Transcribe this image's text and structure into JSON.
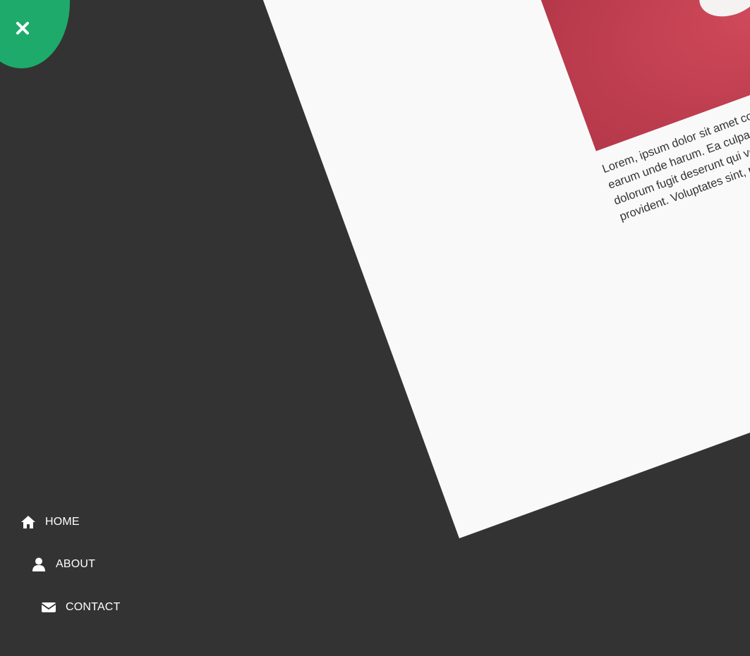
{
  "page": {
    "title_fragment": "p"
  },
  "close_button": {
    "icon": "close-icon",
    "color": "#1eaa6b"
  },
  "nav": {
    "items": [
      {
        "label": "HOME",
        "icon": "home-icon"
      },
      {
        "label": "ABOUT",
        "icon": "user-icon"
      },
      {
        "label": "CONTACT",
        "icon": "envelope-icon"
      }
    ]
  },
  "caption": {
    "lines": [
      "Lorem, ipsum dolor sit amet consectetur adipi",
      "earum unde harum. Ea culpa veritatis magnar",
      "dolorum fugit deserunt qui vero voluptas, ut",
      "provident. Voluptates sint, neque fuga cum"
    ]
  },
  "colors": {
    "sidebar_bg": "#333333",
    "page_bg": "#f9f9f9",
    "accent": "#1eaa6b"
  }
}
